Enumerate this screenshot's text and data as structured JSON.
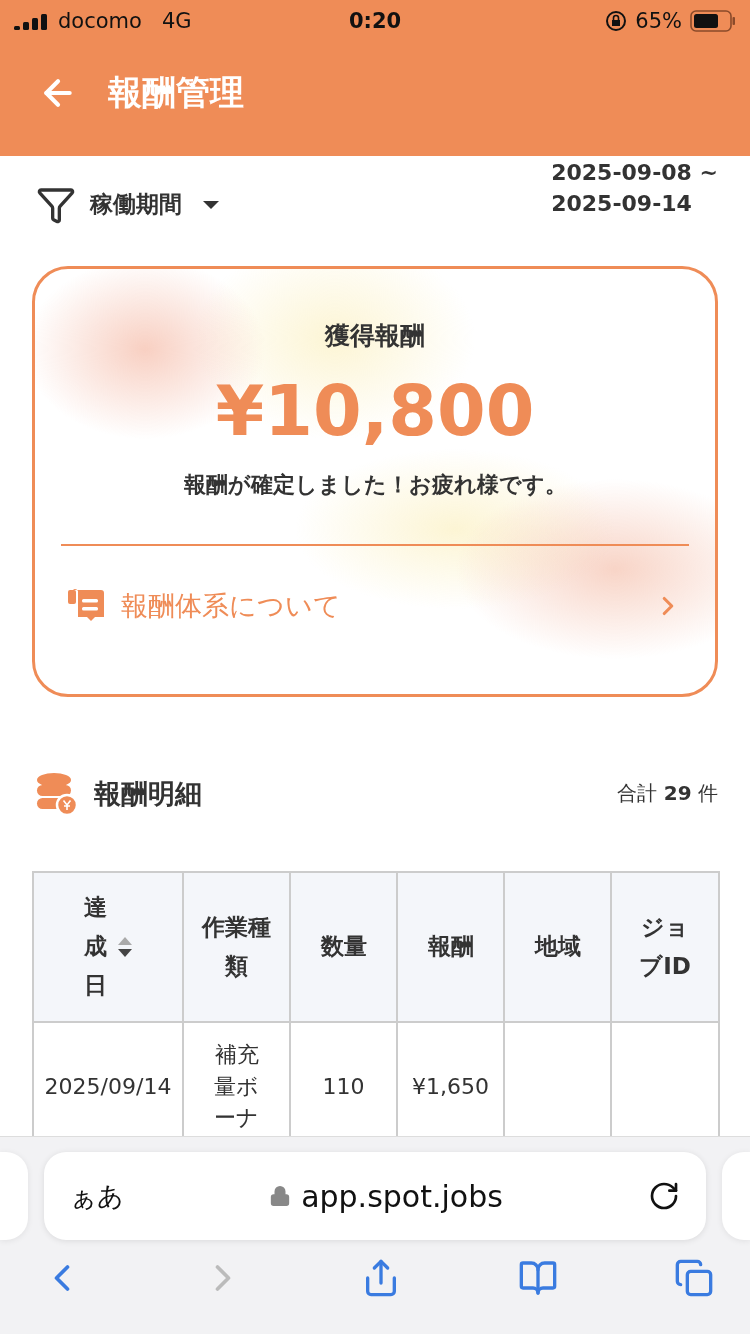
{
  "status_bar": {
    "carrier": "docomo",
    "network": "4G",
    "time": "0:20",
    "battery": "65%"
  },
  "header": {
    "title": "報酬管理"
  },
  "filter": {
    "label": "稼働期間",
    "range_start": "2025-09-08 ~",
    "range_end": "2025-09-14"
  },
  "summary": {
    "title": "獲得報酬",
    "amount": "¥10,800",
    "message": "報酬が確定しました！お疲れ様です。",
    "link": "報酬体系について"
  },
  "details": {
    "title": "報酬明細",
    "count": "合計 **29** 件"
  },
  "table": {
    "columns": [
      {
        "label": "達成日",
        "sortable": true
      },
      {
        "label": "作業種類",
        "sortable": false
      },
      {
        "label": "数量",
        "sortable": false
      },
      {
        "label": "報酬",
        "sortable": false
      },
      {
        "label": "地域",
        "sortable": false
      },
      {
        "label": "ジョブID",
        "sortable": false
      }
    ],
    "rows": [
      {
        "cells": [
          "2025/09/14",
          "補充量ボーナ",
          "110",
          "¥1,650",
          "",
          ""
        ]
      }
    ]
  },
  "browser": {
    "text_size": "ぁあ",
    "url": "app.spot.jobs",
    "toolbar": [
      {
        "kind": "back",
        "disabled": false
      },
      {
        "kind": "forward",
        "disabled": true
      },
      {
        "kind": "share",
        "disabled": false
      },
      {
        "kind": "bookmarks",
        "disabled": false
      },
      {
        "kind": "tabs",
        "disabled": false
      }
    ]
  }
}
